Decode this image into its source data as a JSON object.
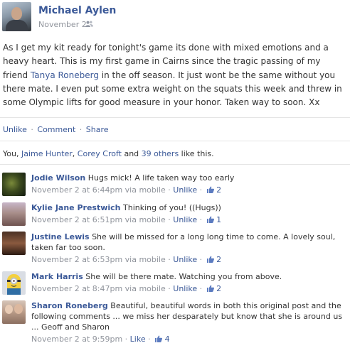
{
  "post": {
    "author": "Michael Aylen",
    "date": "November 2",
    "text_1": "As I get my kit ready for tonight's game its done with mixed emotions and a heavy heart. This is my first game in Cairns since the tragic passing of my friend ",
    "tagged_name": "Tanya Roneberg",
    "text_2": " in the off season. It just wont be the same without you there mate. I even put some extra weight on the squats this week and threw in some Olympic lifts for good measure in your honor. Taken way to soon. Xx"
  },
  "actions": {
    "unlike": "Unlike",
    "comment": "Comment",
    "share": "Share",
    "separator": "·"
  },
  "likes": {
    "prefix": "You, ",
    "person_1": "Jaime Hunter",
    "comma": ", ",
    "person_2": "Corey Croft",
    "and": " and ",
    "others": "39 others",
    "suffix": " like this."
  },
  "comments": [
    {
      "name": "Jodie Wilson",
      "text": "Hugs mick! A life taken way too early",
      "time": "November 2 at 6:44pm via mobile",
      "action": "Unlike",
      "likes": "2"
    },
    {
      "name": "Kylie Jane Prestwich",
      "text": "Thinking of you! ((Hugs))",
      "time": "November 2 at 6:51pm via mobile",
      "action": "Unlike",
      "likes": "1"
    },
    {
      "name": "Justine Lewis",
      "text": "She will be missed for a long long time to come. A lovely soul, taken far too soon.",
      "time": "November 2 at 6:53pm via mobile",
      "action": "Unlike",
      "likes": "2"
    },
    {
      "name": "Mark Harris",
      "text": "She will be there mate. Watching you from above.",
      "time": "November 2 at 8:47pm via mobile",
      "action": "Unlike",
      "likes": "2"
    },
    {
      "name": "Sharon Roneberg",
      "text": "Beautiful, beautiful words in both this original post and the following comments ... we miss her desparately but know that she is around us ... Geoff and Sharon",
      "time": "November 2 at 9:59pm",
      "action": "Like",
      "likes": "4"
    }
  ],
  "colors": {
    "link": "#3b5998",
    "meta": "#90949c",
    "divider": "#e5e5e5"
  }
}
